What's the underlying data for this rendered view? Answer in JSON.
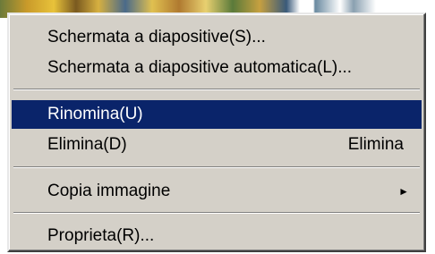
{
  "menu": {
    "items": [
      {
        "label": "Schermata a diapositive(S)...",
        "shortcut": ""
      },
      {
        "label": "Schermata a diapositive automatica(L)...",
        "shortcut": ""
      },
      {
        "label": "Rinomina(U)",
        "shortcut": "",
        "selected": true
      },
      {
        "label": "Elimina(D)",
        "shortcut": "Elimina"
      },
      {
        "label": "Copia immagine",
        "shortcut": "",
        "submenu": true
      },
      {
        "label": "Proprieta(R)...",
        "shortcut": ""
      }
    ],
    "submenu_arrow": "►"
  },
  "colors": {
    "menu_background": "#d4d0c8",
    "selection_background": "#0a246a",
    "selection_text": "#ffffff"
  }
}
